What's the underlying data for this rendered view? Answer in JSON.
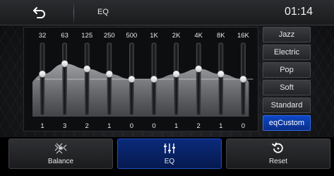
{
  "header": {
    "title": "EQ",
    "clock": "01:14"
  },
  "eq": {
    "bands": [
      {
        "freq": "32",
        "value": "1",
        "level": 1
      },
      {
        "freq": "63",
        "value": "3",
        "level": 3
      },
      {
        "freq": "125",
        "value": "2",
        "level": 2
      },
      {
        "freq": "250",
        "value": "1",
        "level": 1
      },
      {
        "freq": "500",
        "value": "0",
        "level": 0
      },
      {
        "freq": "1K",
        "value": "0",
        "level": 0
      },
      {
        "freq": "2K",
        "value": "1",
        "level": 1
      },
      {
        "freq": "4K",
        "value": "2",
        "level": 2
      },
      {
        "freq": "8K",
        "value": "1",
        "level": 1
      },
      {
        "freq": "16K",
        "value": "0",
        "level": 0
      }
    ],
    "min_level": -7,
    "max_level": 7
  },
  "presets": [
    {
      "label": "Jazz",
      "active": false
    },
    {
      "label": "Electric",
      "active": false
    },
    {
      "label": "Pop",
      "active": false
    },
    {
      "label": "Soft",
      "active": false
    },
    {
      "label": "Standard",
      "active": false
    },
    {
      "label": "eqCustom",
      "active": true
    }
  ],
  "bottom": {
    "balance_label": "Balance",
    "eq_label": "EQ",
    "reset_label": "Reset"
  },
  "icons": {
    "back": "back-arrow-icon",
    "balance": "balance-icon",
    "eq": "equalizer-sliders-icon",
    "reset": "reset-icon"
  },
  "colors": {
    "accent": "#0a2e86",
    "accent_border": "#2e6cf0",
    "curve_fill": "#8a8c90"
  }
}
